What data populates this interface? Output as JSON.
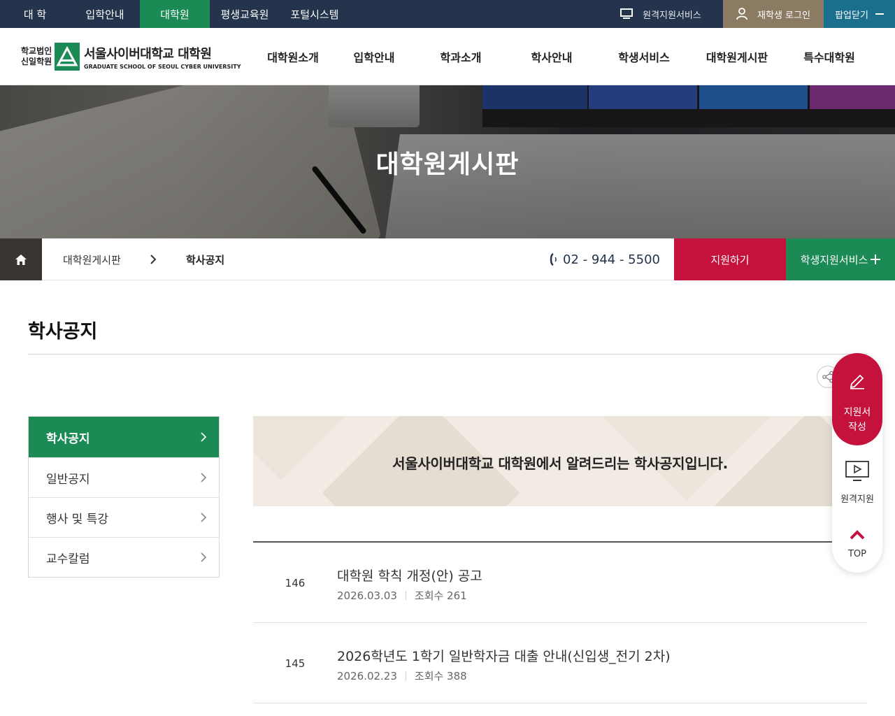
{
  "topbar": {
    "sites": [
      "대 학",
      "입학안내",
      "대학원",
      "평생교육원",
      "포털시스템"
    ],
    "active_site": "대학원",
    "remote_label": "원격지원서비스",
    "login_label": "재학생 로그인",
    "popup_label": "팝업닫기"
  },
  "header": {
    "logo_corp_line1": "학교법인",
    "logo_corp_line2": "신일학원",
    "logo_title": "서울사이버대학교 대학원",
    "logo_subtitle": "GRADUATE SCHOOL OF SEOUL CYBER UNIVERSITY",
    "nav": [
      "대학원소개",
      "입학안내",
      "학과소개",
      "학사안내",
      "학생서비스",
      "대학원게시판",
      "특수대학원"
    ]
  },
  "hero": {
    "title": "대학원게시판"
  },
  "location": {
    "crumb1": "대학원게시판",
    "crumb2": "학사공지",
    "phone": "02 - 944 - 5500",
    "apply_label": "지원하기",
    "support_label": "학생지원서비스"
  },
  "page": {
    "title": "학사공지",
    "intro": "서울사이버대학교 대학원에서 알려드리는 학사공지입니다."
  },
  "sidebar": {
    "items": [
      {
        "label": "학사공지",
        "active": true
      },
      {
        "label": "일반공지",
        "active": false
      },
      {
        "label": "행사 및 특강",
        "active": false
      },
      {
        "label": "교수칼럼",
        "active": false
      }
    ]
  },
  "posts": [
    {
      "num": "146",
      "title": "대학원 학칙 개정(안) 공고",
      "date": "2026.03.03",
      "views": "조회수 261"
    },
    {
      "num": "145",
      "title": "2026학년도 1학기 일반학자금 대출 안내(신입생_전기 2차)",
      "date": "2026.02.23",
      "views": "조회수 388"
    }
  ],
  "quick": {
    "apply_line1": "지원서",
    "apply_line2": "작성",
    "remote": "원격지원",
    "top": "TOP"
  },
  "colors": {
    "navy": "#23344c",
    "green": "#1c8a55",
    "crimson": "#c4123d",
    "login_brown": "#8c7b63",
    "popup_teal": "#1a6e8e"
  }
}
